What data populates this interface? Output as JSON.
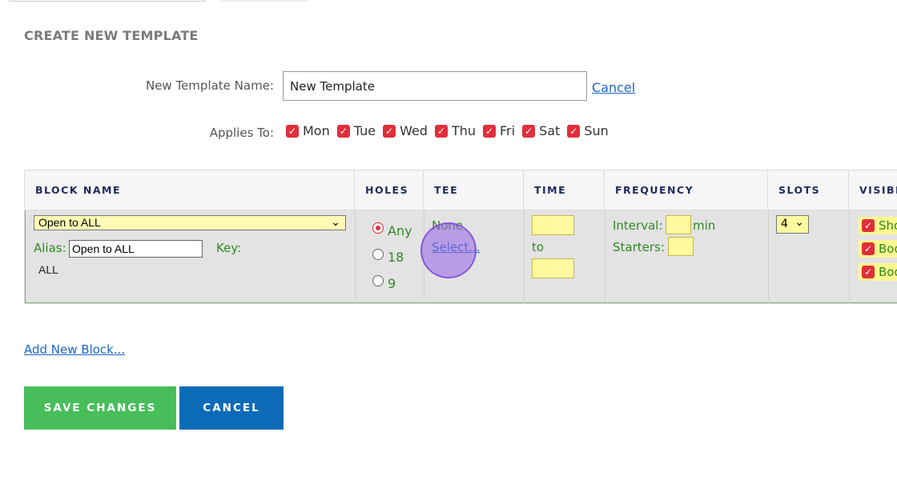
{
  "page": {
    "title": "CREATE NEW TEMPLATE"
  },
  "form": {
    "name_label": "New Template Name:",
    "name_value": "New Template",
    "cancel_link": "Cancel",
    "applies_label": "Applies To:",
    "days": [
      {
        "label": "Mon",
        "checked": true
      },
      {
        "label": "Tue",
        "checked": true
      },
      {
        "label": "Wed",
        "checked": true
      },
      {
        "label": "Thu",
        "checked": true
      },
      {
        "label": "Fri",
        "checked": true
      },
      {
        "label": "Sat",
        "checked": true
      },
      {
        "label": "Sun",
        "checked": true
      }
    ]
  },
  "table": {
    "headers": [
      "BLOCK NAME",
      "HOLES",
      "TEE",
      "TIME",
      "FREQUENCY",
      "SLOTS",
      "VISIBI"
    ],
    "row": {
      "block_name": "Open to ALL",
      "alias_label": "Alias:",
      "alias_value": "Open to ALL",
      "key_label": "Key:",
      "key_value": "ALL",
      "holes": [
        {
          "label": "Any",
          "selected": true
        },
        {
          "label": "18",
          "selected": false
        },
        {
          "label": "9",
          "selected": false
        }
      ],
      "tee_value": "None",
      "tee_select": "Select...",
      "time_to": "to",
      "interval_label": "Interval:",
      "interval_unit": "min",
      "starters_label": "Starters:",
      "slots_value": "4",
      "visibility": [
        {
          "label": "Sho",
          "checked": true
        },
        {
          "label": "Boo",
          "checked": true
        },
        {
          "label": "Boo",
          "checked": true
        }
      ]
    }
  },
  "actions": {
    "add_block": "Add New Block...",
    "save": "SAVE CHANGES",
    "cancel": "CANCEL"
  },
  "colors": {
    "accent_red": "#e02f3a",
    "save_green": "#47be5a",
    "cancel_blue": "#0c6bb7",
    "link_blue": "#1a66c7",
    "row_green_text": "#2e8b20"
  }
}
